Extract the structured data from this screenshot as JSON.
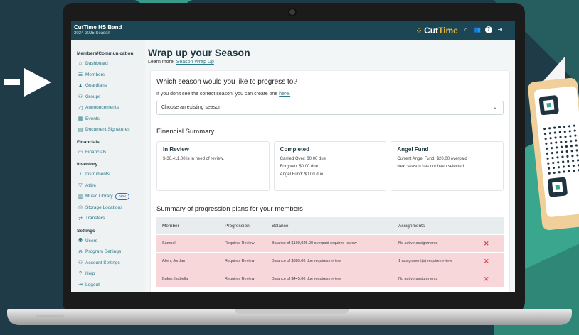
{
  "app": {
    "org_name": "CutTime HS Band",
    "season": "2024-2025 Season",
    "logo_cut": "Cut",
    "logo_time": "Time",
    "top_icons": [
      "home-icon",
      "users-icon",
      "help-icon",
      "logout-icon"
    ]
  },
  "sidebar": {
    "sections": [
      {
        "title": "Members/Communication",
        "items": [
          {
            "label": "Dashboard",
            "icon": "home-icon"
          },
          {
            "label": "Members",
            "icon": "list-icon"
          },
          {
            "label": "Guardians",
            "icon": "guardians-icon"
          },
          {
            "label": "Groups",
            "icon": "groups-icon"
          },
          {
            "label": "Announcements",
            "icon": "megaphone-icon"
          },
          {
            "label": "Events",
            "icon": "calendar-icon"
          },
          {
            "label": "Document Signatures",
            "icon": "document-icon"
          }
        ]
      },
      {
        "title": "Financials",
        "items": [
          {
            "label": "Financials",
            "icon": "money-icon"
          }
        ]
      },
      {
        "title": "Inventory",
        "items": [
          {
            "label": "Instruments",
            "icon": "trumpet-icon"
          },
          {
            "label": "Attire",
            "icon": "shirt-icon"
          },
          {
            "label": "Music Library",
            "icon": "library-icon",
            "badge": "new"
          },
          {
            "label": "Storage Locations",
            "icon": "location-icon"
          },
          {
            "label": "Transfers",
            "icon": "transfer-icon"
          }
        ]
      },
      {
        "title": "Settings",
        "items": [
          {
            "label": "Users",
            "icon": "users-icon"
          },
          {
            "label": "Program Settings",
            "icon": "gear-icon"
          },
          {
            "label": "Account Settings",
            "icon": "account-icon"
          },
          {
            "label": "Help",
            "icon": "help-icon"
          },
          {
            "label": "Logout",
            "icon": "logout-icon"
          }
        ]
      }
    ]
  },
  "main": {
    "title": "Wrap up your Season",
    "learn_prefix": "Learn more: ",
    "learn_link": "Season Wrap Up",
    "question": "Which season would you like to progress to?",
    "note_prefix": "If you don't see the correct season, you can create one ",
    "note_link": "here.",
    "select_placeholder": "Choose an existing season",
    "financial_title": "Financial Summary",
    "financial_cards": [
      {
        "title": "In Review",
        "lines": [
          "$-30,411.00 is in need of review."
        ]
      },
      {
        "title": "Completed",
        "lines": [
          "Carried Over: $0.00 due",
          "Forgiven: $0.00 due",
          "Angel Fund: $0.00 due"
        ]
      },
      {
        "title": "Angel Fund",
        "lines": [
          "Current Angel Fund: $20.00 overpaid",
          "Next season has not been selected"
        ]
      }
    ],
    "summary_title": "Summary of progression plans for your members",
    "table": {
      "headers": [
        "Member",
        "Progression",
        "Balance",
        "Assignments"
      ],
      "rows": [
        {
          "member": "Samuel",
          "progression": "Requires Review",
          "balance": "Balance of $100,025.00 overpaid requires review",
          "assignments": "No active assignments"
        },
        {
          "member": "Allen, Jordan",
          "progression": "Requires Review",
          "balance": "Balance of $385.00 due requires review",
          "assignments": "1 assignment(s) require review"
        },
        {
          "member": "Baker, Isabella",
          "progression": "Requires Review",
          "balance": "Balance of $445.00 due requires review",
          "assignments": "No active assignments"
        }
      ]
    }
  },
  "colors": {
    "topbar": "#1c4654",
    "accent_link": "#2f7a8a",
    "logo_gold": "#e6b43a",
    "review_row": "#f7d7d9",
    "remove_x": "#e04848"
  }
}
